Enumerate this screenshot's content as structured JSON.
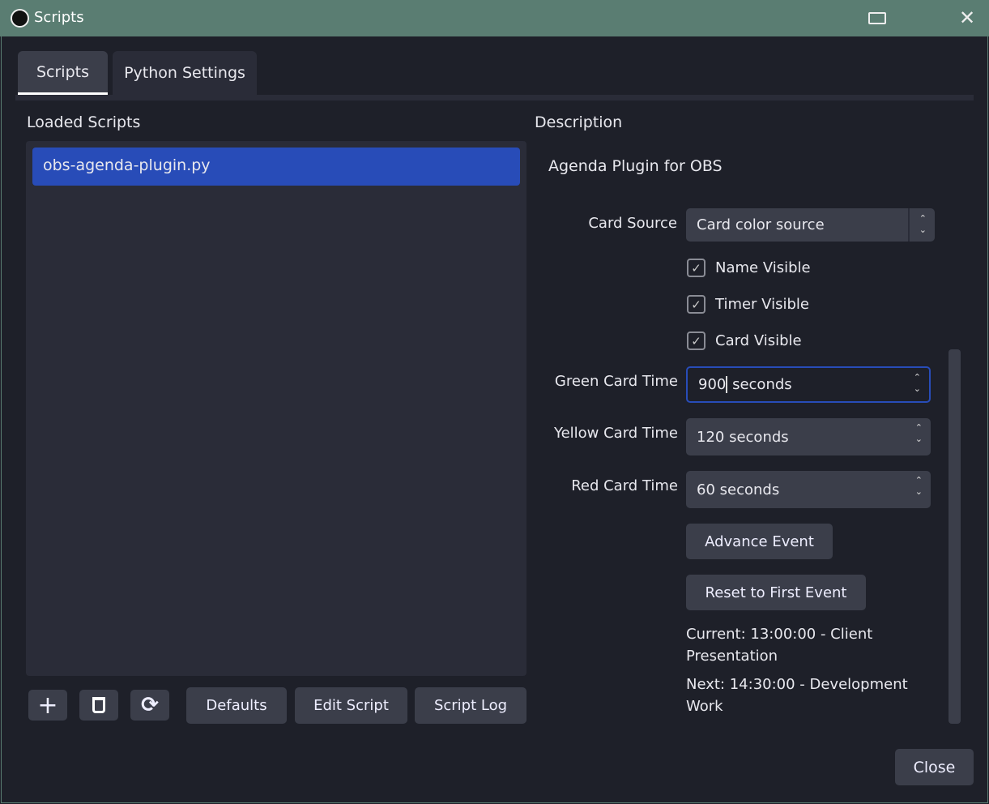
{
  "window": {
    "title": "Scripts"
  },
  "tabs": [
    {
      "label": "Scripts",
      "active": true
    },
    {
      "label": "Python Settings",
      "active": false
    }
  ],
  "loaded_scripts": {
    "header": "Loaded Scripts",
    "items": [
      "obs-agenda-plugin.py"
    ]
  },
  "toolbar": {
    "add_icon": "plus-icon",
    "remove_icon": "trash-icon",
    "reload_icon": "refresh-icon",
    "defaults": "Defaults",
    "edit_script": "Edit Script",
    "script_log": "Script Log"
  },
  "description": {
    "header": "Description",
    "text": "Agenda Plugin for OBS"
  },
  "settings": {
    "card_source": {
      "label": "Card Source",
      "value": "Card color source"
    },
    "checkboxes": [
      {
        "label": "Name Visible",
        "checked": true
      },
      {
        "label": "Timer Visible",
        "checked": true
      },
      {
        "label": "Card Visible",
        "checked": true
      }
    ],
    "green": {
      "label": "Green Card Time",
      "value": "900",
      "suffix": " seconds"
    },
    "yellow": {
      "label": "Yellow Card Time",
      "value": "120 seconds"
    },
    "red": {
      "label": "Red Card Time",
      "value": "60 seconds"
    },
    "advance": "Advance Event",
    "reset": "Reset to First Event",
    "current": "Current: 13:00:00 - Client Presentation",
    "next": "Next: 14:30:00 - Development Work"
  },
  "close": "Close",
  "colors": {
    "accent": "#284cb8",
    "titlebar": "#5a7d72"
  }
}
